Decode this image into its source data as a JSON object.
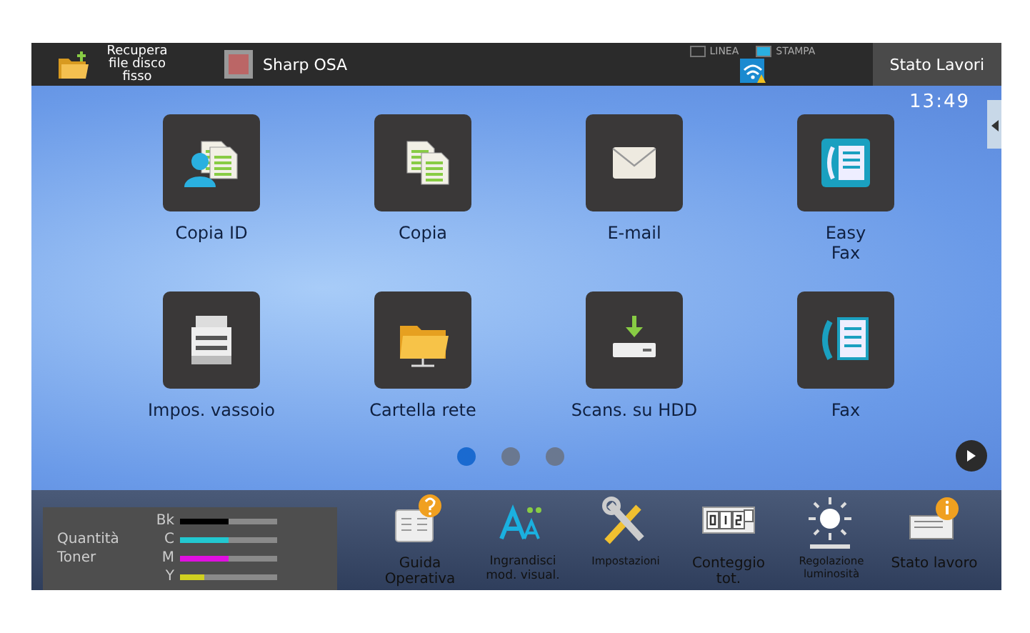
{
  "top_bar": {
    "shortcuts": [
      {
        "label": "Recupera file disco fisso"
      },
      {
        "label": "Sharp OSA"
      }
    ],
    "indicators": [
      {
        "label": "LINEA",
        "on": false
      },
      {
        "label": "STAMPA",
        "on": true
      }
    ],
    "job_status_button": "Stato Lavori"
  },
  "clock": "13:49",
  "apps": [
    {
      "label": "Copia ID"
    },
    {
      "label": "Copia"
    },
    {
      "label": "E-mail"
    },
    {
      "label": "Easy Fax"
    },
    {
      "label": "Impos. vassoio"
    },
    {
      "label": "Cartella rete"
    },
    {
      "label": "Scans. su HDD"
    },
    {
      "label": "Fax"
    }
  ],
  "pages": [
    {
      "selected": true
    },
    {
      "selected": false
    },
    {
      "selected": false
    }
  ],
  "toner": {
    "title": "Quantità Toner",
    "colors": [
      {
        "label": "Bk",
        "color": "#000000",
        "level": 0.5
      },
      {
        "label": "C",
        "color": "#22c8d0",
        "level": 0.5
      },
      {
        "label": "M",
        "color": "#e010e0",
        "level": 0.5
      },
      {
        "label": "Y",
        "color": "#d0d020",
        "level": 0.25
      }
    ]
  },
  "shortcuts": [
    {
      "label": "Guida Operativa"
    },
    {
      "label": "Ingrandisci mod. visual."
    },
    {
      "label": "Impostazioni"
    },
    {
      "label": "Conteggio tot."
    },
    {
      "label": "Regolazione luminosità"
    },
    {
      "label": "Stato lavoro"
    }
  ]
}
